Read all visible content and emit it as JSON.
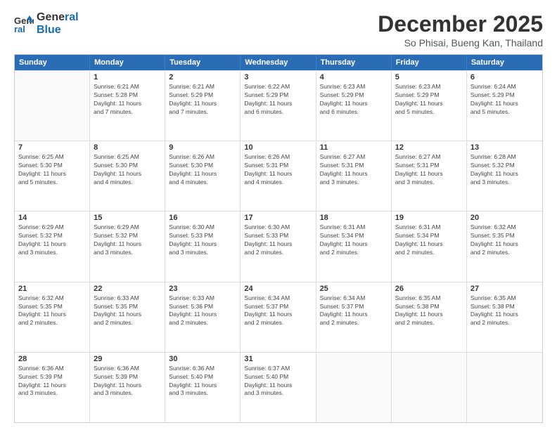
{
  "header": {
    "logo_line1": "General",
    "logo_line2": "Blue",
    "month": "December 2025",
    "location": "So Phisai, Bueng Kan, Thailand"
  },
  "days_of_week": [
    "Sunday",
    "Monday",
    "Tuesday",
    "Wednesday",
    "Thursday",
    "Friday",
    "Saturday"
  ],
  "weeks": [
    [
      {
        "day": "",
        "info": ""
      },
      {
        "day": "1",
        "info": "Sunrise: 6:21 AM\nSunset: 5:28 PM\nDaylight: 11 hours\nand 7 minutes."
      },
      {
        "day": "2",
        "info": "Sunrise: 6:21 AM\nSunset: 5:29 PM\nDaylight: 11 hours\nand 7 minutes."
      },
      {
        "day": "3",
        "info": "Sunrise: 6:22 AM\nSunset: 5:29 PM\nDaylight: 11 hours\nand 6 minutes."
      },
      {
        "day": "4",
        "info": "Sunrise: 6:23 AM\nSunset: 5:29 PM\nDaylight: 11 hours\nand 6 minutes."
      },
      {
        "day": "5",
        "info": "Sunrise: 6:23 AM\nSunset: 5:29 PM\nDaylight: 11 hours\nand 5 minutes."
      },
      {
        "day": "6",
        "info": "Sunrise: 6:24 AM\nSunset: 5:29 PM\nDaylight: 11 hours\nand 5 minutes."
      }
    ],
    [
      {
        "day": "7",
        "info": "Sunrise: 6:25 AM\nSunset: 5:30 PM\nDaylight: 11 hours\nand 5 minutes."
      },
      {
        "day": "8",
        "info": "Sunrise: 6:25 AM\nSunset: 5:30 PM\nDaylight: 11 hours\nand 4 minutes."
      },
      {
        "day": "9",
        "info": "Sunrise: 6:26 AM\nSunset: 5:30 PM\nDaylight: 11 hours\nand 4 minutes."
      },
      {
        "day": "10",
        "info": "Sunrise: 6:26 AM\nSunset: 5:31 PM\nDaylight: 11 hours\nand 4 minutes."
      },
      {
        "day": "11",
        "info": "Sunrise: 6:27 AM\nSunset: 5:31 PM\nDaylight: 11 hours\nand 3 minutes."
      },
      {
        "day": "12",
        "info": "Sunrise: 6:27 AM\nSunset: 5:31 PM\nDaylight: 11 hours\nand 3 minutes."
      },
      {
        "day": "13",
        "info": "Sunrise: 6:28 AM\nSunset: 5:32 PM\nDaylight: 11 hours\nand 3 minutes."
      }
    ],
    [
      {
        "day": "14",
        "info": "Sunrise: 6:29 AM\nSunset: 5:32 PM\nDaylight: 11 hours\nand 3 minutes."
      },
      {
        "day": "15",
        "info": "Sunrise: 6:29 AM\nSunset: 5:32 PM\nDaylight: 11 hours\nand 3 minutes."
      },
      {
        "day": "16",
        "info": "Sunrise: 6:30 AM\nSunset: 5:33 PM\nDaylight: 11 hours\nand 3 minutes."
      },
      {
        "day": "17",
        "info": "Sunrise: 6:30 AM\nSunset: 5:33 PM\nDaylight: 11 hours\nand 2 minutes."
      },
      {
        "day": "18",
        "info": "Sunrise: 6:31 AM\nSunset: 5:34 PM\nDaylight: 11 hours\nand 2 minutes."
      },
      {
        "day": "19",
        "info": "Sunrise: 6:31 AM\nSunset: 5:34 PM\nDaylight: 11 hours\nand 2 minutes."
      },
      {
        "day": "20",
        "info": "Sunrise: 6:32 AM\nSunset: 5:35 PM\nDaylight: 11 hours\nand 2 minutes."
      }
    ],
    [
      {
        "day": "21",
        "info": "Sunrise: 6:32 AM\nSunset: 5:35 PM\nDaylight: 11 hours\nand 2 minutes."
      },
      {
        "day": "22",
        "info": "Sunrise: 6:33 AM\nSunset: 5:35 PM\nDaylight: 11 hours\nand 2 minutes."
      },
      {
        "day": "23",
        "info": "Sunrise: 6:33 AM\nSunset: 5:36 PM\nDaylight: 11 hours\nand 2 minutes."
      },
      {
        "day": "24",
        "info": "Sunrise: 6:34 AM\nSunset: 5:37 PM\nDaylight: 11 hours\nand 2 minutes."
      },
      {
        "day": "25",
        "info": "Sunrise: 6:34 AM\nSunset: 5:37 PM\nDaylight: 11 hours\nand 2 minutes."
      },
      {
        "day": "26",
        "info": "Sunrise: 6:35 AM\nSunset: 5:38 PM\nDaylight: 11 hours\nand 2 minutes."
      },
      {
        "day": "27",
        "info": "Sunrise: 6:35 AM\nSunset: 5:38 PM\nDaylight: 11 hours\nand 2 minutes."
      }
    ],
    [
      {
        "day": "28",
        "info": "Sunrise: 6:36 AM\nSunset: 5:39 PM\nDaylight: 11 hours\nand 3 minutes."
      },
      {
        "day": "29",
        "info": "Sunrise: 6:36 AM\nSunset: 5:39 PM\nDaylight: 11 hours\nand 3 minutes."
      },
      {
        "day": "30",
        "info": "Sunrise: 6:36 AM\nSunset: 5:40 PM\nDaylight: 11 hours\nand 3 minutes."
      },
      {
        "day": "31",
        "info": "Sunrise: 6:37 AM\nSunset: 5:40 PM\nDaylight: 11 hours\nand 3 minutes."
      },
      {
        "day": "",
        "info": ""
      },
      {
        "day": "",
        "info": ""
      },
      {
        "day": "",
        "info": ""
      }
    ]
  ]
}
